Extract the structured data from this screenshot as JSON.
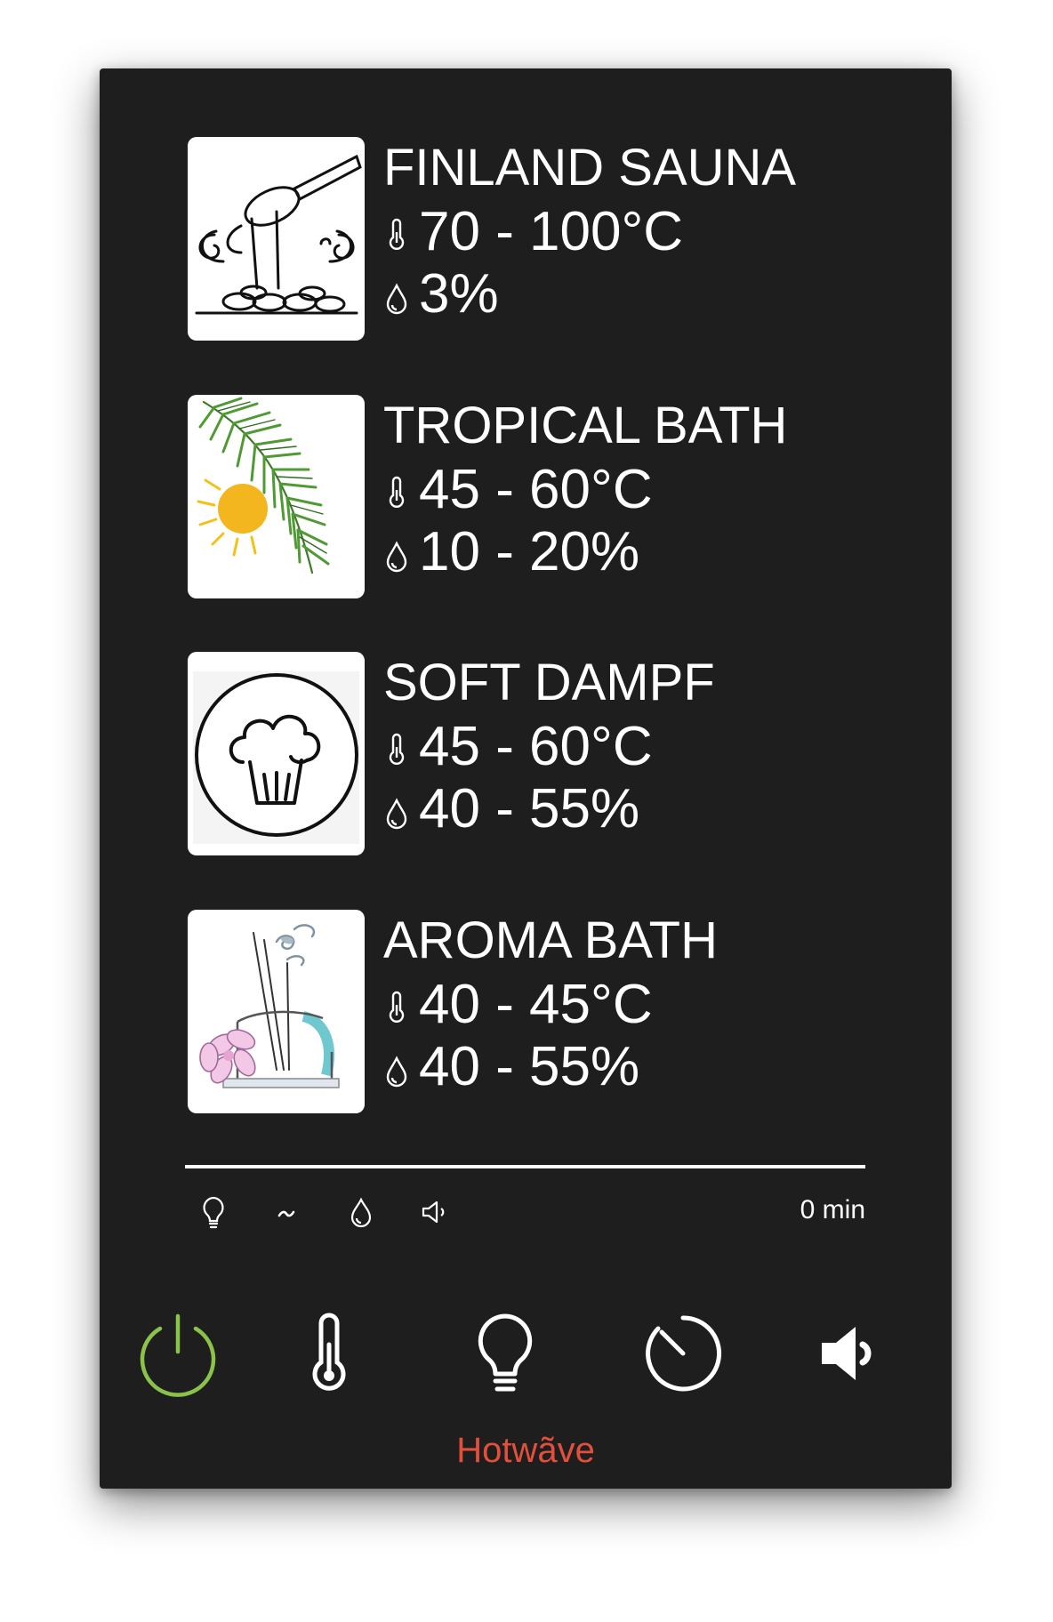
{
  "programs": [
    {
      "name": "FINLAND SAUNA",
      "temperature": "70 - 100°C",
      "humidity": "3%",
      "image": "sauna-ladle-icon"
    },
    {
      "name": "TROPICAL BATH",
      "temperature": "45 - 60°C",
      "humidity": "10 - 20%",
      "image": "palm-leaf-sun-icon"
    },
    {
      "name": "SOFT DAMPF",
      "temperature": "45 - 60°C",
      "humidity": "40 - 55%",
      "image": "steam-cloud-icon"
    },
    {
      "name": "AROMA BATH",
      "temperature": "40 - 45°C",
      "humidity": "40 - 55%",
      "image": "aroma-diffuser-icon"
    }
  ],
  "status": {
    "icons": [
      "light-bulb-icon",
      "fan-wave-icon",
      "water-drop-icon",
      "speaker-icon"
    ],
    "timer": "0 min"
  },
  "controls": [
    "power-icon",
    "thermometer-icon",
    "light-bulb-icon",
    "timer-icon",
    "speaker-icon"
  ],
  "brand": "Hotwãve",
  "colors": {
    "panel": "#1e1e1f",
    "power": "#8bc34a",
    "brand": "#e2503b"
  }
}
